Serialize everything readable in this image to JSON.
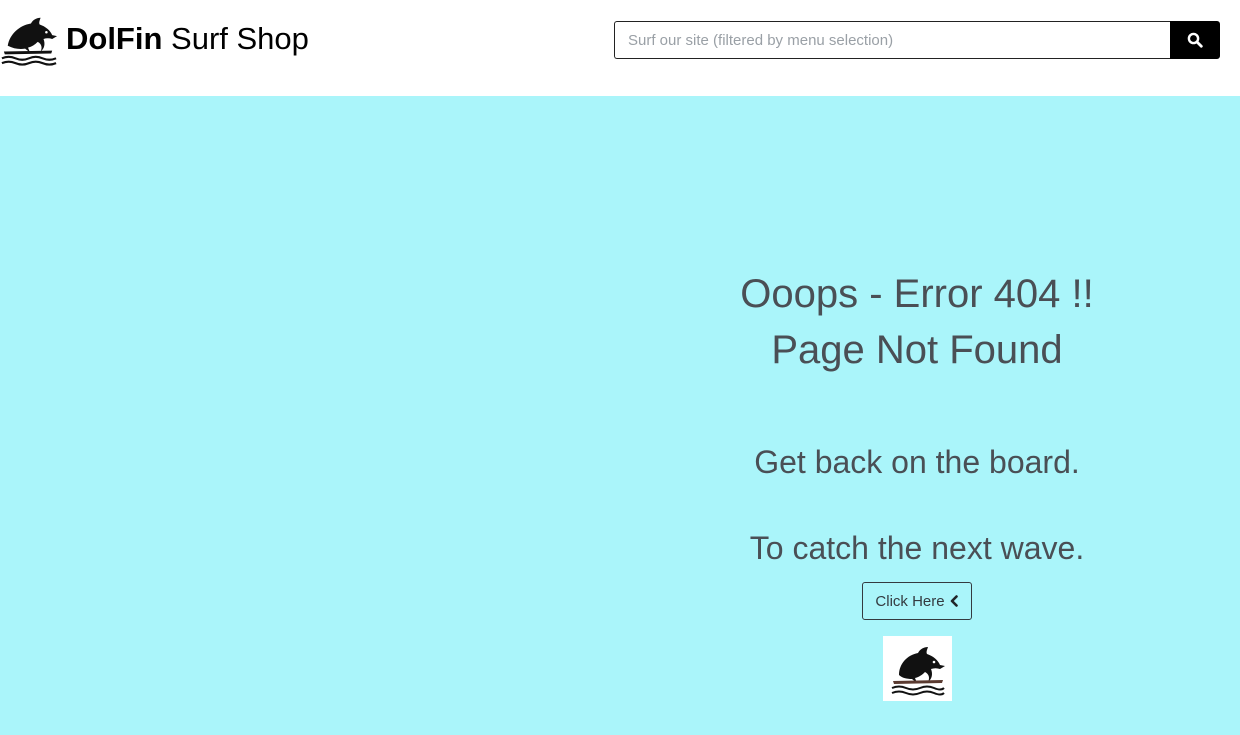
{
  "header": {
    "brand_bold": "DolFin",
    "brand_rest": " Surf Shop",
    "logo_icon": "dolphin-surf-icon"
  },
  "search": {
    "placeholder": "Surf our site (filtered by menu selection)",
    "value": "",
    "button_icon": "search-icon"
  },
  "error": {
    "line1": "Ooops - Error 404 !!",
    "line2": "Page Not Found",
    "message1": "Get back on the board.",
    "message2": "To catch the next wave.",
    "button_label": "Click Here",
    "button_icon": "chevron-left-icon",
    "footer_icon": "dolphin-surf-icon"
  },
  "colors": {
    "background": "#aaf5fa",
    "text": "#4a4f55",
    "search_button": "#000000"
  }
}
